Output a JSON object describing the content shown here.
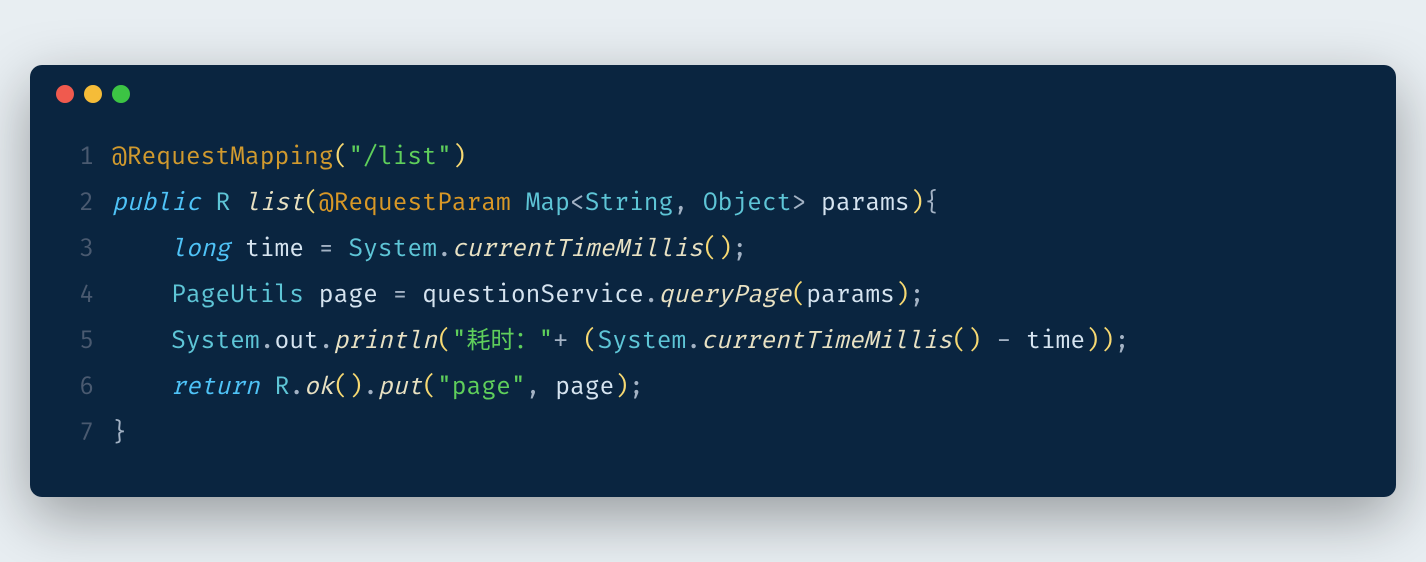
{
  "window": {
    "dots": [
      "red",
      "yellow",
      "green"
    ]
  },
  "code": {
    "lines": [
      {
        "num": "1",
        "tokens": [
          {
            "cls": "tok-annotation",
            "t": "@RequestMapping"
          },
          {
            "cls": "tok-paren",
            "t": "("
          },
          {
            "cls": "tok-string",
            "t": "\"/list\""
          },
          {
            "cls": "tok-paren",
            "t": ")"
          }
        ]
      },
      {
        "num": "2",
        "tokens": [
          {
            "cls": "tok-keyword",
            "t": "public"
          },
          {
            "cls": "tok-punct",
            "t": " "
          },
          {
            "cls": "tok-type",
            "t": "R"
          },
          {
            "cls": "tok-punct",
            "t": " "
          },
          {
            "cls": "tok-method",
            "t": "list"
          },
          {
            "cls": "tok-paren",
            "t": "("
          },
          {
            "cls": "tok-anno-name",
            "t": "@RequestParam"
          },
          {
            "cls": "tok-punct",
            "t": " "
          },
          {
            "cls": "tok-type",
            "t": "Map"
          },
          {
            "cls": "tok-punct",
            "t": "<"
          },
          {
            "cls": "tok-type",
            "t": "String"
          },
          {
            "cls": "tok-punct",
            "t": ", "
          },
          {
            "cls": "tok-type",
            "t": "Object"
          },
          {
            "cls": "tok-punct",
            "t": "> "
          },
          {
            "cls": "tok-ident",
            "t": "params"
          },
          {
            "cls": "tok-paren",
            "t": ")"
          },
          {
            "cls": "tok-punct",
            "t": "{"
          }
        ]
      },
      {
        "num": "3",
        "tokens": [
          {
            "cls": "tok-punct",
            "t": "    "
          },
          {
            "cls": "tok-keyword",
            "t": "long"
          },
          {
            "cls": "tok-punct",
            "t": " "
          },
          {
            "cls": "tok-ident",
            "t": "time"
          },
          {
            "cls": "tok-punct",
            "t": " "
          },
          {
            "cls": "tok-op",
            "t": "="
          },
          {
            "cls": "tok-punct",
            "t": " "
          },
          {
            "cls": "tok-type",
            "t": "System"
          },
          {
            "cls": "tok-punct",
            "t": "."
          },
          {
            "cls": "tok-method",
            "t": "currentTimeMillis"
          },
          {
            "cls": "tok-paren",
            "t": "()"
          },
          {
            "cls": "tok-punct",
            "t": ";"
          }
        ]
      },
      {
        "num": "4",
        "tokens": [
          {
            "cls": "tok-punct",
            "t": "    "
          },
          {
            "cls": "tok-type",
            "t": "PageUtils"
          },
          {
            "cls": "tok-punct",
            "t": " "
          },
          {
            "cls": "tok-ident",
            "t": "page"
          },
          {
            "cls": "tok-punct",
            "t": " "
          },
          {
            "cls": "tok-op",
            "t": "="
          },
          {
            "cls": "tok-punct",
            "t": " "
          },
          {
            "cls": "tok-ident",
            "t": "questionService"
          },
          {
            "cls": "tok-punct",
            "t": "."
          },
          {
            "cls": "tok-method",
            "t": "queryPage"
          },
          {
            "cls": "tok-paren",
            "t": "("
          },
          {
            "cls": "tok-ident",
            "t": "params"
          },
          {
            "cls": "tok-paren",
            "t": ")"
          },
          {
            "cls": "tok-punct",
            "t": ";"
          }
        ]
      },
      {
        "num": "5",
        "tokens": [
          {
            "cls": "tok-punct",
            "t": "    "
          },
          {
            "cls": "tok-type",
            "t": "System"
          },
          {
            "cls": "tok-punct",
            "t": "."
          },
          {
            "cls": "tok-ident",
            "t": "out"
          },
          {
            "cls": "tok-punct",
            "t": "."
          },
          {
            "cls": "tok-method",
            "t": "println"
          },
          {
            "cls": "tok-paren",
            "t": "("
          },
          {
            "cls": "tok-string",
            "t": "\"耗时：\""
          },
          {
            "cls": "tok-op",
            "t": "+"
          },
          {
            "cls": "tok-punct",
            "t": " "
          },
          {
            "cls": "tok-paren",
            "t": "("
          },
          {
            "cls": "tok-type",
            "t": "System"
          },
          {
            "cls": "tok-punct",
            "t": "."
          },
          {
            "cls": "tok-method",
            "t": "currentTimeMillis"
          },
          {
            "cls": "tok-paren",
            "t": "()"
          },
          {
            "cls": "tok-punct",
            "t": " "
          },
          {
            "cls": "tok-op",
            "t": "-"
          },
          {
            "cls": "tok-punct",
            "t": " "
          },
          {
            "cls": "tok-ident",
            "t": "time"
          },
          {
            "cls": "tok-paren",
            "t": "))"
          },
          {
            "cls": "tok-punct",
            "t": ";"
          }
        ]
      },
      {
        "num": "6",
        "tokens": [
          {
            "cls": "tok-punct",
            "t": "    "
          },
          {
            "cls": "tok-keyword",
            "t": "return"
          },
          {
            "cls": "tok-punct",
            "t": " "
          },
          {
            "cls": "tok-type",
            "t": "R"
          },
          {
            "cls": "tok-punct",
            "t": "."
          },
          {
            "cls": "tok-method",
            "t": "ok"
          },
          {
            "cls": "tok-paren",
            "t": "()"
          },
          {
            "cls": "tok-punct",
            "t": "."
          },
          {
            "cls": "tok-method",
            "t": "put"
          },
          {
            "cls": "tok-paren",
            "t": "("
          },
          {
            "cls": "tok-string",
            "t": "\"page\""
          },
          {
            "cls": "tok-punct",
            "t": ", "
          },
          {
            "cls": "tok-ident",
            "t": "page"
          },
          {
            "cls": "tok-paren",
            "t": ")"
          },
          {
            "cls": "tok-punct",
            "t": ";"
          }
        ]
      },
      {
        "num": "7",
        "tokens": [
          {
            "cls": "tok-punct",
            "t": "}"
          }
        ]
      }
    ]
  }
}
